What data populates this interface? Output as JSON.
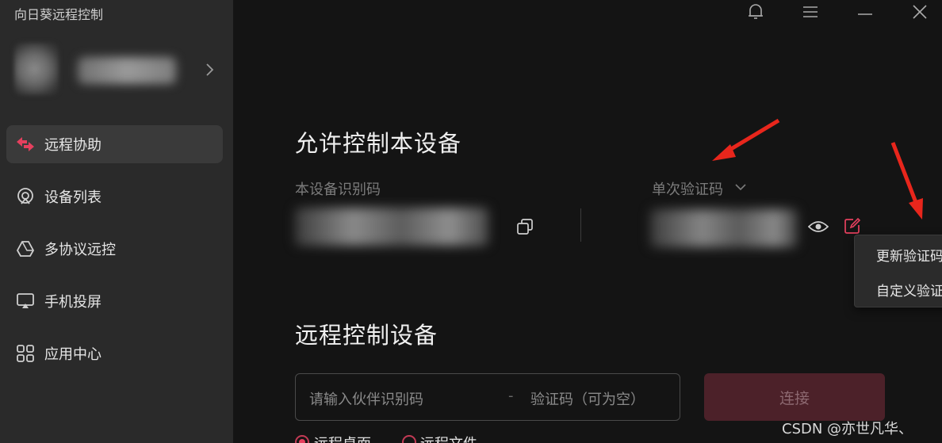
{
  "app": {
    "title": "向日葵远程控制"
  },
  "sidebar": {
    "items": [
      {
        "label": "远程协助",
        "icon": "remote-assist-icon"
      },
      {
        "label": "设备列表",
        "icon": "device-list-icon"
      },
      {
        "label": "多协议远控",
        "icon": "multi-protocol-icon"
      },
      {
        "label": "手机投屏",
        "icon": "screen-cast-icon"
      },
      {
        "label": "应用中心",
        "icon": "app-center-icon"
      }
    ]
  },
  "allow": {
    "title": "允许控制本设备",
    "device_id_label": "本设备识别码",
    "code_type_label": "单次验证码"
  },
  "menu": {
    "items": [
      "更新验证码",
      "自定义验证码"
    ]
  },
  "remote": {
    "title": "远程控制设备",
    "partner_placeholder": "请输入伙伴识别码",
    "separator": "-",
    "code_placeholder": "验证码（可为空）",
    "connect_label": "连接",
    "options": [
      "远程桌面",
      "远程文件"
    ]
  },
  "watermark": "CSDN @亦世凡华、",
  "colors": {
    "accent": "#e5405e",
    "annotation_arrow": "#e8261c"
  }
}
